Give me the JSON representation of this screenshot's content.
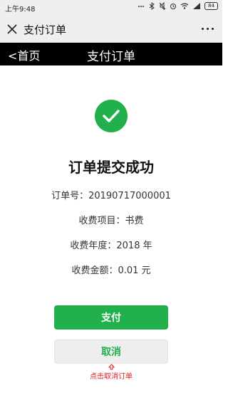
{
  "status": {
    "time": "上午9:48",
    "battery": "84"
  },
  "wechat": {
    "title": "支付订单"
  },
  "header": {
    "back_label": "<首页",
    "title": "支付订单"
  },
  "result": {
    "title": "订单提交成功",
    "order_no": "订单号：20190717000001",
    "item": "收费项目：书费",
    "year": "收费年度：2018 年",
    "amount": "收费金额：0.01 元"
  },
  "actions": {
    "pay_label": "支付",
    "cancel_label": "取消",
    "cancel_hint": "点击取消订单"
  },
  "colors": {
    "accent": "#22b04c",
    "hint": "#e02020",
    "header_bg": "#000000"
  }
}
